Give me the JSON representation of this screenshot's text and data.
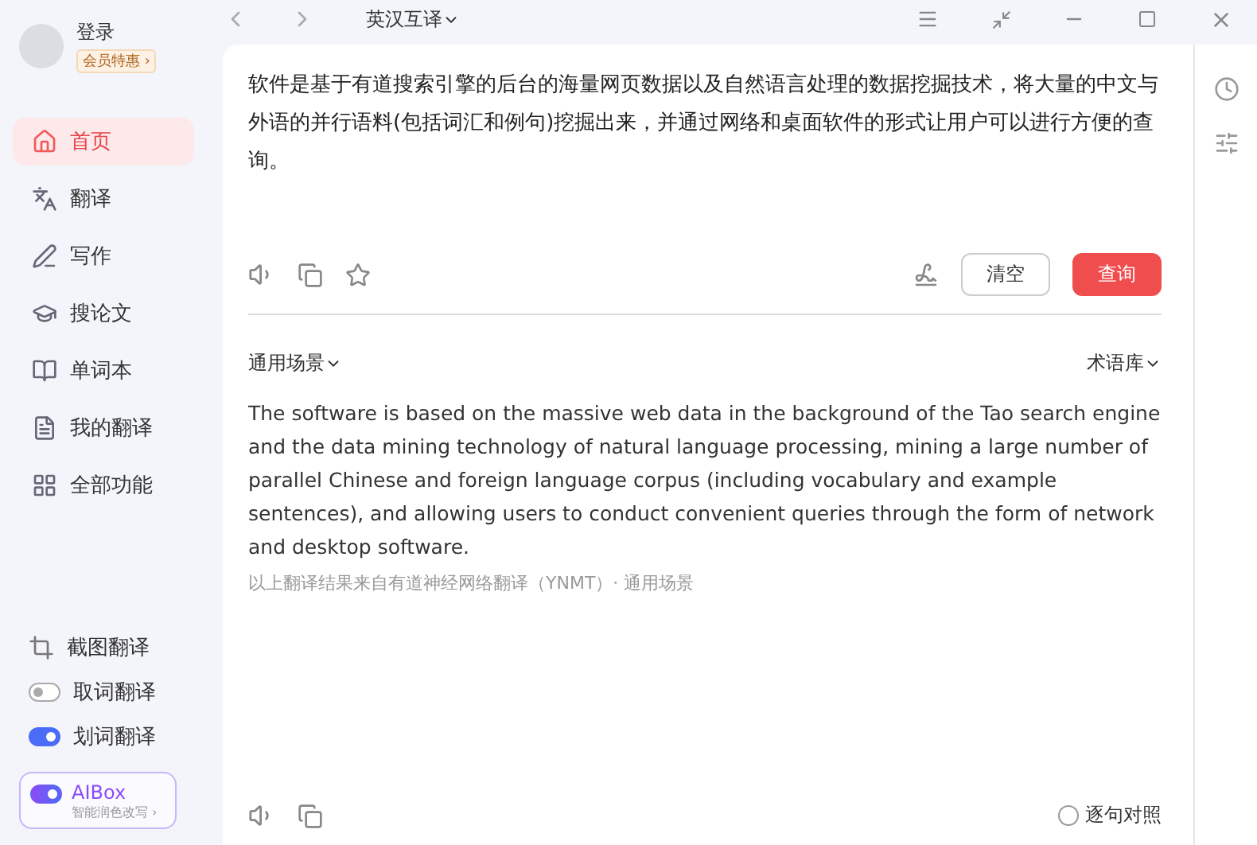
{
  "user": {
    "login": "登录",
    "badge": "会员特惠 ›"
  },
  "nav": [
    {
      "label": "首页",
      "selected": true
    },
    {
      "label": "翻译",
      "selected": false
    },
    {
      "label": "写作",
      "selected": false
    },
    {
      "label": "搜论文",
      "selected": false
    },
    {
      "label": "单词本",
      "selected": false
    },
    {
      "label": "我的翻译",
      "selected": false
    },
    {
      "label": "全部功能",
      "selected": false
    }
  ],
  "tools": [
    {
      "kind": "crop",
      "label": "截图翻译"
    },
    {
      "kind": "toggle",
      "label": "取词翻译",
      "on": false
    },
    {
      "kind": "toggle",
      "label": "划词翻译",
      "on": true
    }
  ],
  "aibox": {
    "title": "AIBox",
    "subtitle": "智能润色改写 ›",
    "on": true
  },
  "topbar": {
    "language": "英汉互译"
  },
  "input": {
    "text": "软件是基于有道搜索引擎的后台的海量网页数据以及自然语言处理的数据挖掘技术，将大量的中文与外语的并行语料(包括词汇和例句)挖掘出来，并通过网络和桌面软件的形式让用户可以进行方便的查询。",
    "clear": "清空",
    "query": "查询"
  },
  "result": {
    "scene": "通用场景",
    "termbase": "术语库",
    "text": "The software is based on the massive web data in the background of the Tao search engine and the data mining technology of natural language processing, mining a large number of parallel Chinese and foreign language corpus (including vocabulary and example sentences), and allowing users to conduct convenient queries through the form of network and desktop software.",
    "source": "以上翻译结果来自有道神经网络翻译（YNMT）· 通用场景",
    "compare": {
      "label": "逐句对照",
      "checked": false
    }
  }
}
